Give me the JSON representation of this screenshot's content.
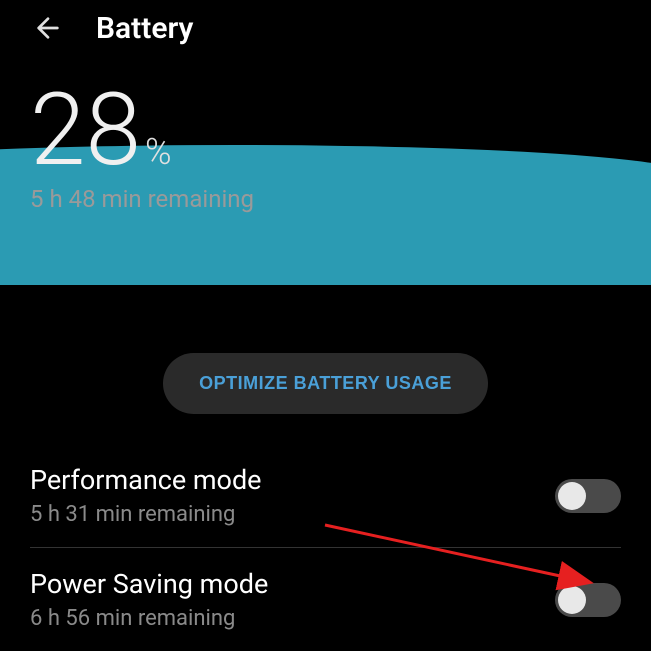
{
  "header": {
    "title": "Battery"
  },
  "battery": {
    "percent": "28",
    "percent_sign": "%",
    "remaining": "5 h 48 min remaining"
  },
  "optimize": {
    "label": "OPTIMIZE BATTERY USAGE"
  },
  "modes": [
    {
      "title": "Performance mode",
      "sub": "5 h 31 min remaining",
      "enabled": false
    },
    {
      "title": "Power Saving mode",
      "sub": "6 h 56 min remaining",
      "enabled": false
    }
  ]
}
